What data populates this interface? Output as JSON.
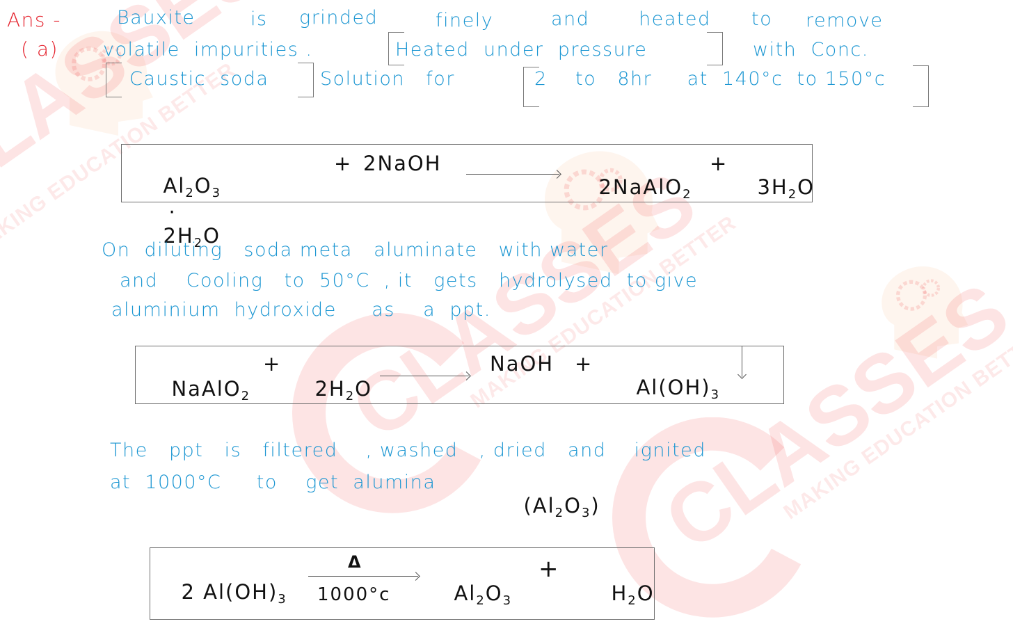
{
  "watermark": {
    "brand": "CLASSES",
    "tagline": "MAKING EDUCATION BETTER"
  },
  "answer_label": {
    "ans": "Ans -",
    "part": "( a)"
  },
  "paragraph1": {
    "line1": [
      "Bauxite",
      "is",
      "grinded",
      "finely",
      "and",
      "heated",
      "to",
      "remove"
    ],
    "line2_a": "volatile  impurities .",
    "line2_boxed": "Heated  under  pressure",
    "line2_b": "with  Conc.",
    "line3_boxed1": "Caustic  soda",
    "line3_a": "Solution   for",
    "line3_boxed2": "2    to   8hr     at  140°c  to 150°c"
  },
  "equation1": {
    "reactants": [
      "Al₂O₃ · 2H₂O",
      "+",
      "2NaOH"
    ],
    "products": [
      "2NaAlO₂",
      "+",
      "3H₂O"
    ],
    "reactant_1": "Al",
    "reactant_1_sub1": "2",
    "reactant_1_b": "O",
    "reactant_1_sub2": "3",
    "dot": "·",
    "reactant_2": "2H",
    "reactant_2_sub": "2",
    "reactant_2_b": "O",
    "plus1": "+",
    "reactant_3": "2NaOH",
    "product_1": "2NaAlO",
    "product_1_sub": "2",
    "plus2": "+",
    "product_2": "3H",
    "product_2_sub": "2",
    "product_2_b": "O"
  },
  "paragraph2": {
    "line1": "On  diluting   soda meta   aluminate   with water",
    "line2": "and    Cooling   to  50°C  , it   gets   hydrolysed  to give",
    "line3": "aluminium  hydroxide     as    a  ppt."
  },
  "equation2": {
    "reactant_1": "NaAlO",
    "reactant_1_sub": "2",
    "plus1": "+",
    "reactant_2": "2H",
    "reactant_2_sub": "2",
    "reactant_2_b": "O",
    "product_1": "NaOH",
    "plus2": "+",
    "product_2": "Al(OH)",
    "product_2_sub": "3",
    "precipitate_symbol": "down-arrow-icon"
  },
  "paragraph3": {
    "line1": "The   ppt   is   filtered    , washed   , dried   and    ignited",
    "line2": "at  1000°C     to    get  alumina"
  },
  "paragraph3_formula": {
    "open": "(Al",
    "sub1": "2",
    "mid": "O",
    "sub2": "3",
    "close": ")"
  },
  "equation3": {
    "reactant_1": "2 Al(OH)",
    "reactant_1_sub": "3",
    "condition_above": "Δ",
    "condition_below": "1000°c",
    "product_1": "Al",
    "product_1_sub1": "2",
    "product_1_b": "O",
    "product_1_sub2": "3",
    "plus": "+",
    "product_2": "H",
    "product_2_sub": "2",
    "product_2_b": "O"
  },
  "colors": {
    "handwriting_blue": "#1b96d2",
    "label_red": "#e5232e",
    "equation_black": "#111111",
    "box_border": "#6d6d6d",
    "watermark": "#f05a5a"
  }
}
